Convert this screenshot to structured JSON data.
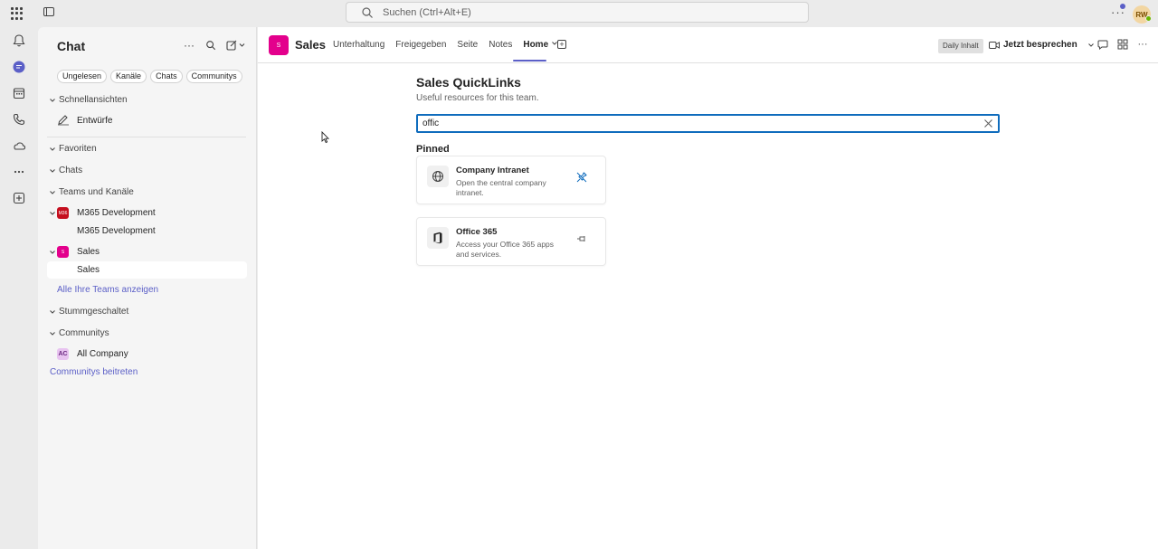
{
  "topbar": {
    "search_placeholder": "Suchen (Ctrl+Alt+E)",
    "avatar_initials": "RW"
  },
  "rail": {
    "items": [
      "activity",
      "chat",
      "calendar",
      "calls",
      "onedrive",
      "more",
      "apps"
    ]
  },
  "chat_pane": {
    "title": "Chat",
    "filters": [
      "Ungelesen",
      "Kanäle",
      "Chats",
      "Communitys"
    ],
    "sections": {
      "quick": "Schnellansichten",
      "drafts": "Entwürfe",
      "favorites": "Favoriten",
      "chats": "Chats",
      "teams": "Teams und Kanäle",
      "team1": "M365 Development",
      "team1_badge": "M36",
      "team1_channel": "M365 Development",
      "team2": "Sales",
      "team2_badge": "S",
      "team2_channel": "Sales",
      "show_all": "Alle Ihre Teams anzeigen",
      "muted": "Stummgeschaltet",
      "communities": "Communitys",
      "community1": "All Company",
      "community1_badge": "AC",
      "join": "Communitys beitreten"
    }
  },
  "header": {
    "team_tile": "S",
    "team_name": "Sales",
    "tabs": [
      "Unterhaltung",
      "Freigegeben",
      "Seite",
      "Notes",
      "Home"
    ],
    "daily": "Daily Inhalt",
    "meet": "Jetzt besprechen"
  },
  "quicklinks": {
    "title": "Sales QuickLinks",
    "subtitle": "Useful resources for this team.",
    "filter_value": "offic",
    "pinned_heading": "Pinned",
    "cards": [
      {
        "title": "Company Intranet",
        "desc": "Open the central company intranet."
      },
      {
        "title": "Office 365",
        "desc": "Access your Office 365 apps and services."
      }
    ]
  },
  "colors": {
    "accent": "#5b5fc7",
    "team_sales": "#e3008c",
    "team_m365": "#c50f1f",
    "focus_blue": "#0f6cbd"
  }
}
